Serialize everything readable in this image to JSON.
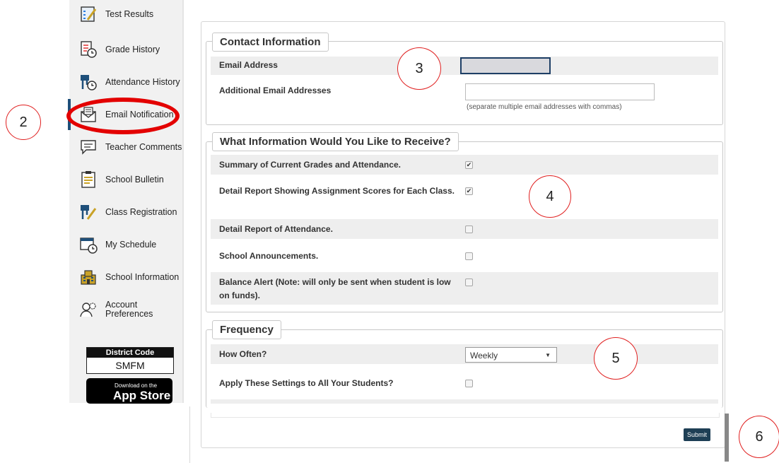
{
  "sidebar": {
    "items": [
      {
        "label": "Test Results",
        "icon": "test-results-icon"
      },
      {
        "label": "Grade History",
        "icon": "grade-history-icon"
      },
      {
        "label": "Attendance History",
        "icon": "attendance-history-icon"
      },
      {
        "label": "Email Notification",
        "icon": "email-icon"
      },
      {
        "label": "Teacher Comments",
        "icon": "comments-icon"
      },
      {
        "label": "School Bulletin",
        "icon": "bulletin-icon"
      },
      {
        "label": "Class Registration",
        "icon": "class-registration-icon"
      },
      {
        "label": "My Schedule",
        "icon": "schedule-icon"
      },
      {
        "label": "School Information",
        "icon": "school-icon"
      },
      {
        "label": "Account Preferences",
        "icon": "account-preferences-icon"
      }
    ],
    "district": {
      "heading": "District Code",
      "code": "SMFM"
    },
    "appstore": {
      "small": "Download on the",
      "big": "App Store"
    }
  },
  "contact": {
    "legend": "Contact Information",
    "email_label": "Email Address",
    "email_value": "",
    "additional_label": "Additional Email Addresses",
    "additional_value": "",
    "hint": "(separate multiple email addresses with commas)"
  },
  "info": {
    "legend": "What Information Would You Like to Receive?",
    "options": [
      {
        "label": "Summary of Current Grades and Attendance.",
        "checked": true
      },
      {
        "label": "Detail Report Showing Assignment Scores for Each Class.",
        "checked": true
      },
      {
        "label": "Detail Report of Attendance.",
        "checked": false
      },
      {
        "label": "School Announcements.",
        "checked": false
      },
      {
        "label": "Balance Alert (Note: will only be sent when student is low on funds).",
        "checked": false
      }
    ]
  },
  "frequency": {
    "legend": "Frequency",
    "how_often_label": "How Often?",
    "how_often_value": "Weekly",
    "apply_label": "Apply These Settings to All Your Students?",
    "apply_checked": false
  },
  "submit_label": "Submit",
  "annotations": [
    "2",
    "3",
    "4",
    "5",
    "6"
  ],
  "colors": {
    "annotation_red": "#e30000",
    "accent_navy": "#1e3f66"
  }
}
